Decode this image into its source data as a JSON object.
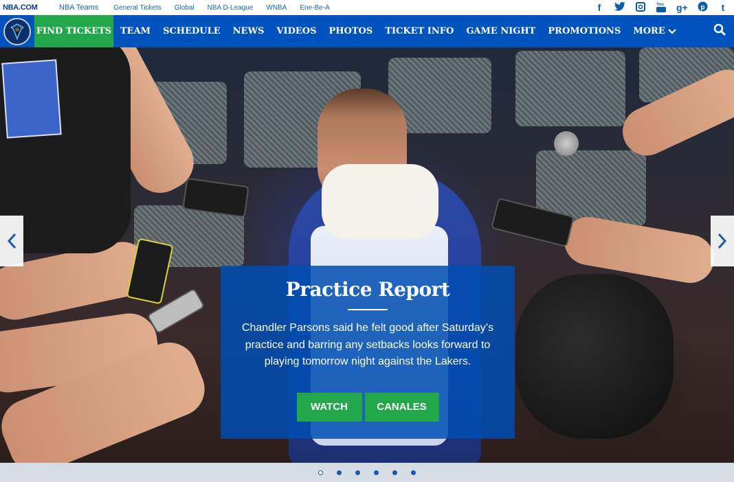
{
  "topbar": {
    "logo": "NBA.COM",
    "links": [
      "NBA Teams",
      "General Tickets",
      "Global",
      "NBA D-League",
      "WNBA",
      "Ene-Be-A"
    ],
    "social_icons": [
      "facebook-icon",
      "twitter-icon",
      "instagram-icon",
      "youtube-icon",
      "google-plus-icon",
      "pinterest-icon",
      "tumblr-icon"
    ],
    "social_glyphs": [
      "f",
      "t",
      "◎",
      "▶",
      "g+",
      "p",
      "t"
    ]
  },
  "nav": {
    "find_tickets": "FIND TICKETS",
    "items": [
      "TEAM",
      "SCHEDULE",
      "NEWS",
      "VIDEOS",
      "PHOTOS",
      "TICKET INFO",
      "GAME NIGHT",
      "PROMOTIONS"
    ],
    "more": "MORE",
    "colors": {
      "nav_bg": "#0053bc",
      "find_tickets_bg": "#22a74a"
    }
  },
  "hero": {
    "title": "Practice Report",
    "description": "Chandler Parsons said he felt good after Saturday’s practice and barring any setbacks looks forward to playing tomorrow night against the Lakers.",
    "buttons": {
      "watch": "WATCH",
      "canales": "CANALES"
    },
    "prev_arrow": "‹",
    "next_arrow": "›"
  },
  "carousel": {
    "dot_count": 6,
    "active_index": 0
  }
}
